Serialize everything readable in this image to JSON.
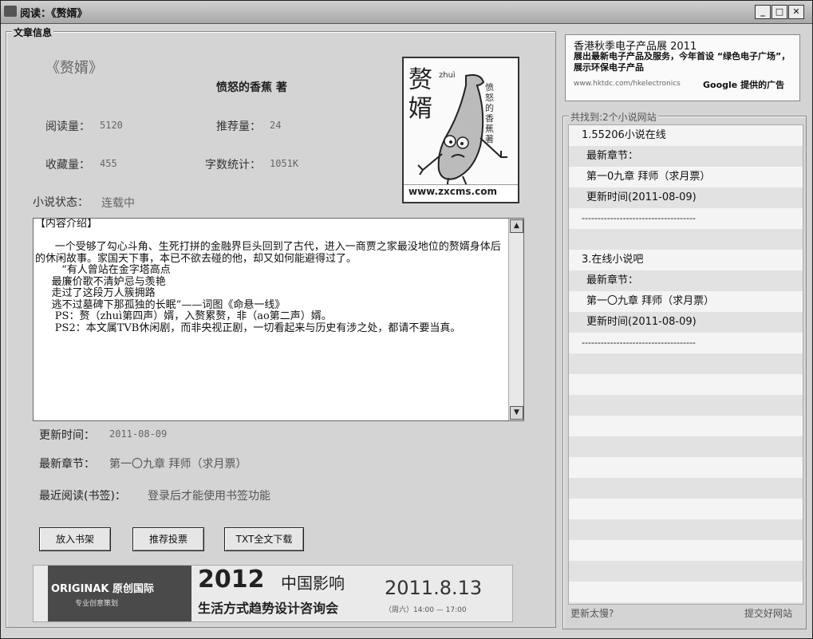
{
  "window": {
    "title": "阅读：《赘婿》",
    "minimize": "_",
    "maximize": "□",
    "close": "✕"
  },
  "article": {
    "group_label": "文章信息",
    "title": "《赘婿》",
    "author": "愤怒的香蕉  著",
    "read_label": "阅读量：",
    "read_value": "5120",
    "recommend_label": "推荐量：",
    "recommend_value": "24",
    "favorite_label": "收藏量：",
    "favorite_value": "455",
    "words_label": "字数统计：",
    "words_value": "1051K",
    "status_label": "小说状态：",
    "status_value": "连载中",
    "cover": {
      "title_chars": [
        "赘",
        "婿"
      ],
      "pinyin": "zhuì",
      "side_text": [
        "愤",
        "怒",
        "的",
        "香",
        "蕉",
        "",
        "著"
      ],
      "site": "www.zxcms.com"
    },
    "intro": "【内容介绍】\n\n      一个受够了勾心斗角、生死打拼的金融界巨头回到了古代，进入一商贾之家最没地位的赘婿身体后的休闲故事。家国天下事，本已不欲去碰的他，却又如何能避得过了。\n        “有人曾站在金字塔高点\n     最廉价歌不清妒忌与羡艳\n     走过了这段万人簇拥路\n     逃不过墓碑下那孤独的长眠”——词图《命悬一线》\n      PS：赘（zhuì第四声）婿，入赘累赘，非（ao第二声）婿。\n      PS2：本文属TVB休闲剧，而非央视正剧，一切看起来与历史有涉之处，都请不要当真。",
    "update_time_label": "更新时间：",
    "update_time_value": "2011-08-09",
    "latest_label": "最新章节：",
    "latest_value": "第一〇九章 拜师（求月票）",
    "recent_label": "最近阅读(书签)：",
    "recent_value": "登录后才能使用书签功能",
    "buttons": {
      "shelf": "放入书架",
      "vote": "推荐投票",
      "download": "TXT全文下载"
    },
    "banner": {
      "brand": "ORIGINAK 原创国际",
      "brand_sub": "专业创意策划",
      "year": "2012",
      "slogan": "中国影响",
      "subtitle": "生活方式趋势设计咨询会",
      "date": "2011.8.13",
      "time_text": "（周六）14:00 — 17:00"
    }
  },
  "ad": {
    "line1": "香港秋季电子产品展 2011",
    "line2": "展出最新电子产品及服务，今年首设 “绿色电子广场”，展示环保电子产品",
    "url": "www.hktdc.com/hkelectronics",
    "provider": "Google 提供的广告"
  },
  "sites": {
    "group_label": "共找到:2个小说网站",
    "rows": [
      "1.55206小说在线",
      "  最新章节：",
      "  第一0九章 拜师（求月票）",
      "  更新时间(2011-08-09)",
      "------------------------------------",
      "",
      "3.在线小说吧",
      "  最新章节：",
      "  第一〇九章 拜师（求月票）",
      "  更新时间(2011-08-09)",
      "------------------------------------"
    ],
    "footer_left": "更新太慢?",
    "footer_right": "提交好网站"
  }
}
